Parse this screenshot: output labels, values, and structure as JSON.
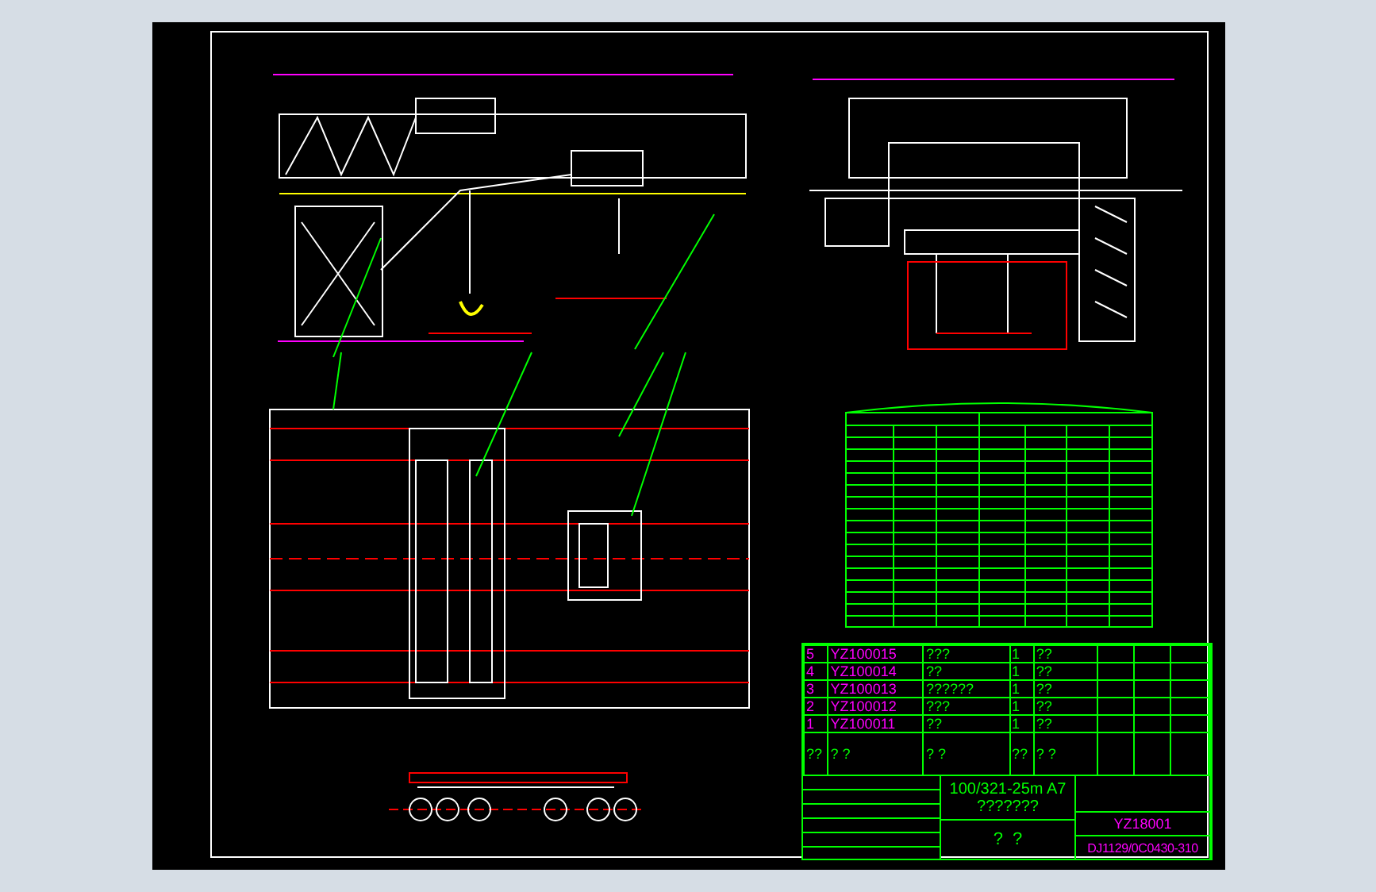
{
  "bom": [
    {
      "index": "5",
      "code": "YZ100015",
      "name": "???",
      "qty": "1",
      "material": "??"
    },
    {
      "index": "4",
      "code": "YZ100014",
      "name": "??",
      "qty": "1",
      "material": "??"
    },
    {
      "index": "3",
      "code": "YZ100013",
      "name": "??????",
      "qty": "1",
      "material": "??"
    },
    {
      "index": "2",
      "code": "YZ100012",
      "name": "???",
      "qty": "1",
      "material": "??"
    },
    {
      "index": "1",
      "code": "YZ100011",
      "name": "??",
      "qty": "1",
      "material": "??"
    }
  ],
  "bom_header": [
    "??",
    "?  ?",
    "?  ?",
    "??",
    "?  ?"
  ],
  "title_block": {
    "title": "100/321-25m A7",
    "subtitle": "???????",
    "company": "?  ?",
    "drawing_number": "YZ18001",
    "file_code": "DJ1129/0C0430-310"
  }
}
